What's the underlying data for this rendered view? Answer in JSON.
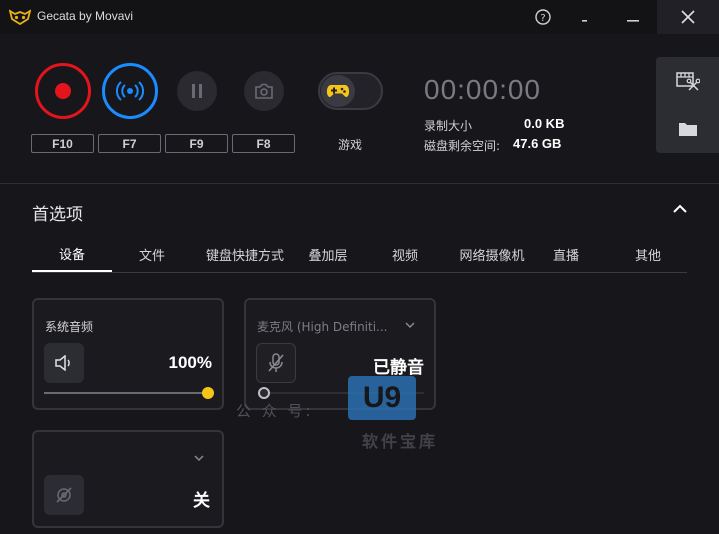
{
  "window": {
    "title": "Gecata by Movavi",
    "help_icon": "?",
    "minimize_icon": "–",
    "maximize_icon": "–",
    "close_icon": "✕"
  },
  "controls": {
    "record_hotkey": "F10",
    "stream_hotkey": "F7",
    "pause_hotkey": "F9",
    "screenshot_hotkey": "F8",
    "game_label": "游戏",
    "timer": "00:00:00",
    "recording_size_label": "录制大小",
    "recording_size_value": "0.0 KB",
    "disk_free_label": "磁盘剩余空间:",
    "disk_free_value": "47.6 GB"
  },
  "colors": {
    "record": "#e4141c",
    "stream": "#1a8cff",
    "game_icon": "#f5c518",
    "volume_thumb": "#f5c518"
  },
  "preferences": {
    "title": "首选项",
    "tabs": [
      {
        "label": "设备",
        "active": true
      },
      {
        "label": "文件",
        "active": false
      },
      {
        "label": "键盘快捷方式",
        "active": false
      },
      {
        "label": "叠加层",
        "active": false
      },
      {
        "label": "视频",
        "active": false
      },
      {
        "label": "网络摄像机",
        "active": false
      },
      {
        "label": "直播",
        "active": false
      },
      {
        "label": "其他",
        "active": false
      }
    ]
  },
  "devices": {
    "system_audio": {
      "title": "系统音频",
      "value": "100%",
      "level": 1.0
    },
    "microphone": {
      "title": "麦克风 (High Definiti...",
      "value": "已静音",
      "level": 0.0
    },
    "webcam": {
      "title": "",
      "value": "关"
    }
  },
  "watermark": {
    "line1": "公 众 号:",
    "logo": "U9",
    "line2": "软件宝库"
  }
}
